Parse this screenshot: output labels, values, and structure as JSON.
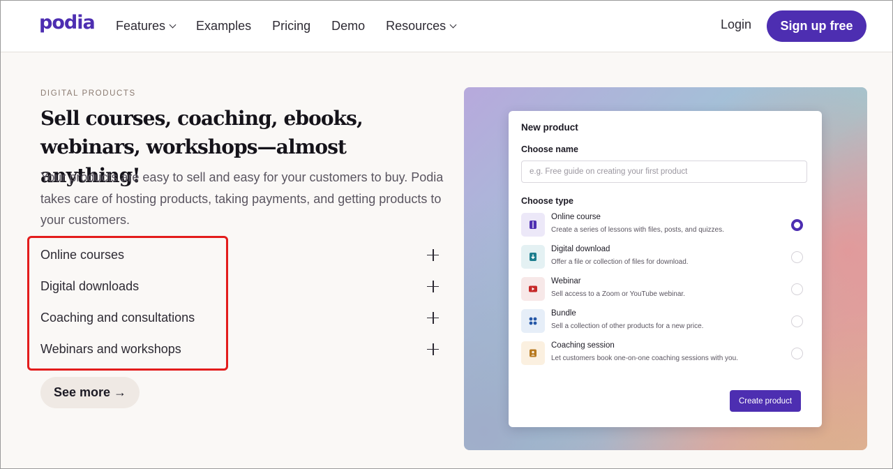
{
  "header": {
    "logo": "podia",
    "nav": [
      {
        "label": "Features",
        "has_dropdown": true
      },
      {
        "label": "Examples",
        "has_dropdown": false
      },
      {
        "label": "Pricing",
        "has_dropdown": false
      },
      {
        "label": "Demo",
        "has_dropdown": false
      },
      {
        "label": "Resources",
        "has_dropdown": true
      }
    ],
    "login_label": "Login",
    "signup_label": "Sign up free"
  },
  "hero": {
    "eyebrow": "DIGITAL PRODUCTS",
    "headline": "Sell courses, coaching, ebooks, webinars, workshops—almost anything!",
    "lead": "Your products are easy to sell and easy for your customers to buy. Podia takes care of hosting products, taking payments, and getting products to your customers.",
    "accordion": [
      {
        "label": "Online courses"
      },
      {
        "label": "Digital downloads"
      },
      {
        "label": "Coaching and consultations"
      },
      {
        "label": "Webinars and workshops"
      }
    ],
    "see_more_label": "See more →"
  },
  "new_product_card": {
    "title": "New product",
    "choose_name_label": "Choose name",
    "name_placeholder": "e.g. Free guide on creating your first product",
    "choose_type_label": "Choose type",
    "types": [
      {
        "name": "Online course",
        "desc": "Create a series of lessons with files, posts, and quizzes.",
        "icon": "course-icon",
        "selected": true
      },
      {
        "name": "Digital download",
        "desc": "Offer a file or collection of files for download.",
        "icon": "download-icon",
        "selected": false
      },
      {
        "name": "Webinar",
        "desc": "Sell access to a Zoom or YouTube webinar.",
        "icon": "play-icon",
        "selected": false
      },
      {
        "name": "Bundle",
        "desc": "Sell a collection of other products for a new price.",
        "icon": "bundle-icon",
        "selected": false
      },
      {
        "name": "Coaching session",
        "desc": "Let customers book one-on-one coaching sessions with you.",
        "icon": "person-icon",
        "selected": false
      }
    ],
    "create_label": "Create product"
  },
  "colors": {
    "brand": "#4d2eb1",
    "highlight": "#e31c1c",
    "page_bg": "#faf8f6"
  }
}
